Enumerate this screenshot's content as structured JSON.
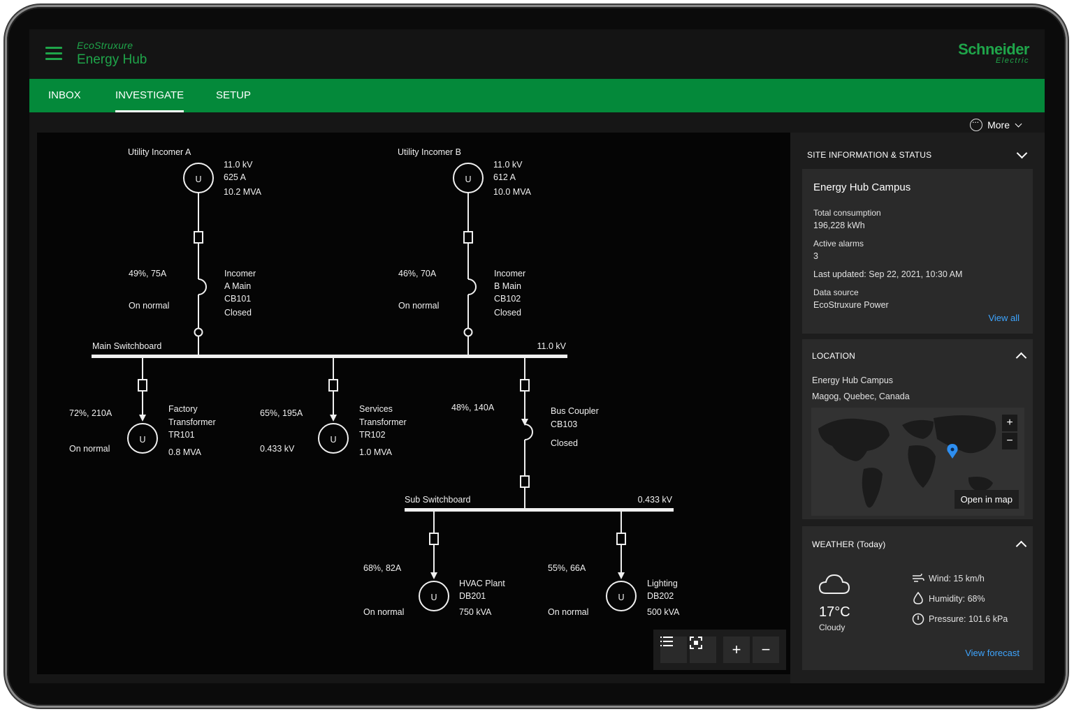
{
  "app": {
    "brand_line1": "EcoStruxure",
    "brand_line2": "Energy Hub",
    "vendor_line1": "Schneider",
    "vendor_line2": "Electric"
  },
  "tabs": [
    {
      "label": "INBOX"
    },
    {
      "label": "INVESTIGATE"
    },
    {
      "label": "SETUP"
    }
  ],
  "toolbar": {
    "more_label": "More"
  },
  "diagram": {
    "incomer_a": {
      "title": "Utility Incomer A",
      "symbol": "U",
      "voltage": "11.0 kV",
      "current": "625 A",
      "power": "10.2 MVA",
      "load": "49%, 75A",
      "state": "On normal",
      "breaker_l1": "Incomer",
      "breaker_l2": "A Main",
      "breaker_l3": "CB101",
      "breaker_l4": "Closed"
    },
    "incomer_b": {
      "title": "Utility Incomer B",
      "symbol": "U",
      "voltage": "11.0 kV",
      "current": "612 A",
      "power": "10.0 MVA",
      "load": "46%, 70A",
      "state": "On normal",
      "breaker_l1": "Incomer",
      "breaker_l2": "B Main",
      "breaker_l3": "CB102",
      "breaker_l4": "Closed"
    },
    "main_bus": {
      "label": "Main Switchboard",
      "voltage": "11.0 kV"
    },
    "factory": {
      "load": "72%, 210A",
      "state": "On normal",
      "symbol": "U",
      "l1": "Factory",
      "l2": "Transformer",
      "l3": "TR101",
      "l4": "0.8 MVA"
    },
    "services": {
      "load": "65%, 195A",
      "state": "0.433 kV",
      "symbol": "U",
      "l1": "Services",
      "l2": "Transformer",
      "l3": "TR102",
      "l4": "1.0 MVA"
    },
    "coupler": {
      "load": "48%, 140A",
      "l1": "Bus Coupler",
      "l2": "CB103",
      "l3": "Closed"
    },
    "sub_bus": {
      "label": "Sub Switchboard",
      "voltage": "0.433 kV"
    },
    "hvac": {
      "load": "68%, 82A",
      "state": "On normal",
      "symbol": "U",
      "l1": "HVAC Plant",
      "l2": "DB201",
      "l3": "750 kVA"
    },
    "lighting": {
      "load": "55%, 66A",
      "state": "On normal",
      "symbol": "U",
      "l1": "Lighting",
      "l2": "DB202",
      "l3": "500 kVA"
    }
  },
  "site": {
    "section_title": "SITE INFORMATION & STATUS",
    "name": "Energy Hub Campus",
    "consumption_label": "Total consumption",
    "consumption_value": "196,228 kWh",
    "alarms_label": "Active alarms",
    "alarms_value": "3",
    "last_updated": "Last updated: Sep 22, 2021, 10:30 AM",
    "source_label": "Data source",
    "source_value": "EcoStruxure Power",
    "view_all": "View all"
  },
  "location": {
    "section_title": "LOCATION",
    "name": "Energy Hub Campus",
    "address": "Magog, Quebec, Canada",
    "zoom_in": "+",
    "zoom_out": "−",
    "open_map": "Open in map"
  },
  "weather": {
    "section_title": "WEATHER",
    "section_suffix": "(Today)",
    "temperature": "17°C",
    "condition": "Cloudy",
    "wind": "Wind: 15 km/h",
    "humidity": "Humidity: 68%",
    "pressure": "Pressure: 101.6 kPa",
    "forecast_link": "View forecast"
  },
  "colors": {
    "brand_green": "#1fa54a",
    "tab_bar": "#04893a",
    "link": "#3ea5ff"
  },
  "icons": {
    "menu": "hamburger-icon",
    "more": "more-dots-icon",
    "list": "list-icon",
    "fit": "fit-screen-icon",
    "plus": "plus-icon",
    "minus": "minus-icon",
    "pin": "map-pin-icon",
    "cloud": "cloud-icon",
    "wind": "wind-icon",
    "drop": "humidity-icon",
    "gauge": "pressure-icon"
  }
}
